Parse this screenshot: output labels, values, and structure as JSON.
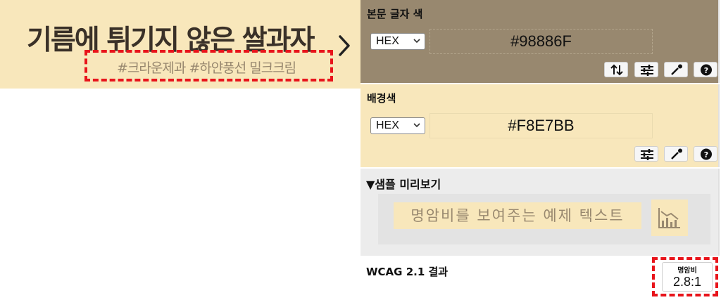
{
  "banner": {
    "title": "기름에 튀기지 않은 쌀과자",
    "subtitle": "#크라운제과 #하얀풍선 밀크크림"
  },
  "foreground": {
    "label": "본문 글자 색",
    "format": "HEX",
    "value": "#98886F",
    "buttons": [
      "swap-icon",
      "sliders-icon",
      "eyedropper-icon",
      "help-icon"
    ]
  },
  "background": {
    "label": "배경색",
    "format": "HEX",
    "value": "#F8E7BB",
    "buttons": [
      "sliders-icon",
      "eyedropper-icon",
      "help-icon"
    ]
  },
  "sample": {
    "title": "▼샘플 미리보기",
    "text": "명암비를 보여주는 예제 텍스트"
  },
  "result": {
    "label": "WCAG 2.1 결과",
    "ratio_label": "명암비",
    "ratio_value": "2.8:1"
  },
  "colors": {
    "foreground": "#98886F",
    "background": "#F8E7BB",
    "highlight": "#e8141b",
    "title_text": "#3a3128"
  }
}
